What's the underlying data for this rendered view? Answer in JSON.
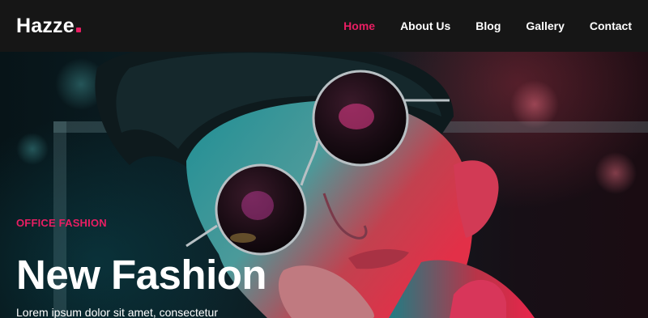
{
  "header": {
    "brand": "Hazze",
    "nav": [
      {
        "label": "Home",
        "active": true
      },
      {
        "label": "About Us",
        "active": false
      },
      {
        "label": "Blog",
        "active": false
      },
      {
        "label": "Gallery",
        "active": false
      },
      {
        "label": "Contact",
        "active": false
      }
    ]
  },
  "hero": {
    "eyebrow": "OFFICE FASHION",
    "title": "New Fashion",
    "description": "Lorem ipsum dolor sit amet, consectetur"
  },
  "colors": {
    "accent": "#e91e63",
    "header_bg": "#161616",
    "text": "#ffffff"
  },
  "icons": {
    "brand_dot": "square-dot-icon"
  }
}
